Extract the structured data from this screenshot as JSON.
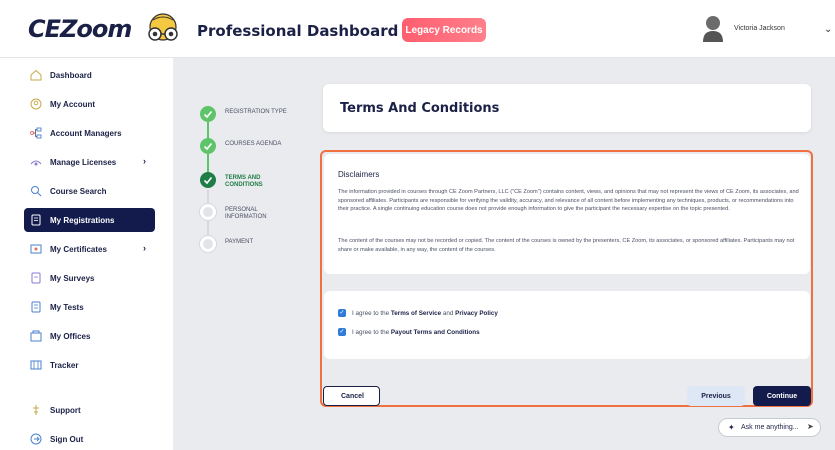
{
  "header": {
    "logo_text": "CEZoom",
    "title": "Professional Dashboard",
    "legacy_label": "Legacy Records",
    "user_name": "Victoria Jackson",
    "chevron": "⌄"
  },
  "sidebar": {
    "items": [
      {
        "label": "Dashboard",
        "icon": "home-icon"
      },
      {
        "label": "My Account",
        "icon": "user-icon"
      },
      {
        "label": "Account Managers",
        "icon": "network-icon"
      },
      {
        "label": "Manage Licenses",
        "icon": "license-icon",
        "arrow": "›"
      },
      {
        "label": "Course Search",
        "icon": "search-icon"
      },
      {
        "label": "My Registrations",
        "icon": "registration-icon"
      },
      {
        "label": "My Certificates",
        "icon": "certificate-icon",
        "arrow": "›"
      },
      {
        "label": "My Surveys",
        "icon": "survey-icon"
      },
      {
        "label": "My Tests",
        "icon": "test-icon"
      },
      {
        "label": "My Offices",
        "icon": "office-icon"
      },
      {
        "label": "Tracker",
        "icon": "tracker-icon"
      },
      {
        "label": "Support",
        "icon": "support-icon"
      },
      {
        "label": "Sign Out",
        "icon": "sign-out-icon"
      }
    ],
    "active_index": 5
  },
  "stepper": {
    "steps": [
      {
        "label": "REGISTRATION TYPE",
        "state": "done"
      },
      {
        "label": "COURSES AGENDA",
        "state": "done"
      },
      {
        "label": "TERMS AND CONDITIONS",
        "state": "current"
      },
      {
        "label": "PERSONAL INFORMATION",
        "state": "todo"
      },
      {
        "label": "PAYMENT",
        "state": "todo"
      }
    ]
  },
  "terms": {
    "title": "Terms And Conditions"
  },
  "disclaimer": {
    "title": "Disclaimers",
    "p1": "The information provided in courses through CE Zoom Partners, LLC (\"CE Zoom\") contains content, views, and opinions that may not represent the views of CE Zoom, its associates, and sponsored affiliates. Participants are responsible for verifying the validity, accuracy, and relevance of all content before implementing any techniques, products, or recommendations into their practice. A single continuing education course does not provide enough information to give the participant the necessary expertise on the topic presented.",
    "p2": "The content of the courses may not be recorded or copied. The content of the courses is owned by the presenters, CE Zoom, its associates, or sponsored affiliates. Participants may not share or make available, in any way, the content of the courses."
  },
  "agreements": {
    "row1_prefix": "I agree to the ",
    "row1_link1": "Terms of Service",
    "row1_mid": " and ",
    "row1_link2": "Privacy Policy",
    "row2_prefix": "I agree to the ",
    "row2_link": "Payout Terms and Conditions",
    "check_glyph": "✓"
  },
  "buttons": {
    "cancel": "Cancel",
    "previous": "Previous",
    "continue": "Continue"
  },
  "assistant": {
    "label": "Ask me anything...",
    "spark": "✦",
    "send": "➤"
  },
  "colors": {
    "navy": "#121b4c",
    "accent_orange": "#f07040",
    "step_done": "#5ec46a",
    "step_current": "#1f7d46",
    "legacy": "#ff6b79"
  }
}
